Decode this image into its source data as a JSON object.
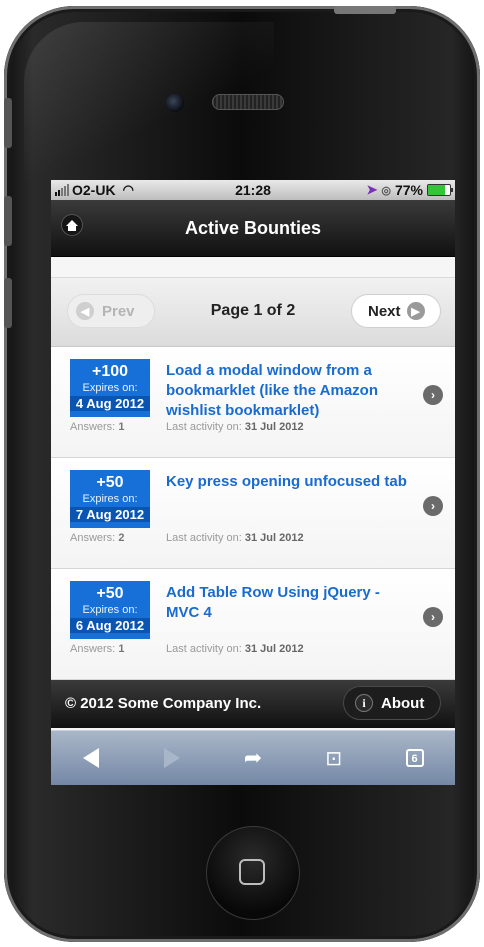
{
  "status_bar": {
    "carrier": "O2-UK",
    "time": "21:28",
    "battery_percent": "77%",
    "battery_level": 0.77,
    "icons": [
      "signal-icon",
      "wifi-icon",
      "location-icon",
      "alarm-icon",
      "battery-icon"
    ]
  },
  "header": {
    "title": "Active Bounties",
    "home_icon": "home-icon"
  },
  "pager": {
    "prev_label": "Prev",
    "next_label": "Next",
    "page_label": "Page 1 of 2"
  },
  "bounties": [
    {
      "bounty": "+100",
      "expires_label": "Expires on:",
      "expires_date": "4 Aug 2012",
      "answers_label": "Answers:",
      "answers": "1",
      "title": "Load a modal window from a bookmarklet (like the Amazon wishlist bookmarklet)",
      "activity_label": "Last activity on:",
      "activity_date": "31 Jul 2012"
    },
    {
      "bounty": "+50",
      "expires_label": "Expires on:",
      "expires_date": "7 Aug 2012",
      "answers_label": "Answers:",
      "answers": "2",
      "title": "Key press opening unfocused tab",
      "activity_label": "Last activity on:",
      "activity_date": "31 Jul 2012"
    },
    {
      "bounty": "+50",
      "expires_label": "Expires on:",
      "expires_date": "6 Aug 2012",
      "answers_label": "Answers:",
      "answers": "1",
      "title": "Add Table Row Using jQuery - MVC 4",
      "activity_label": "Last activity on:",
      "activity_date": "31 Jul 2012"
    }
  ],
  "footer": {
    "copyright": "© 2012 Some Company Inc.",
    "about_label": "About"
  },
  "toolbar": {
    "tabs_count": "6"
  },
  "colors": {
    "accent_blue": "#1670d8",
    "title_blue": "#1a6bd0",
    "header_dark": "#111111",
    "toolbar_blue": "#7488a6"
  }
}
